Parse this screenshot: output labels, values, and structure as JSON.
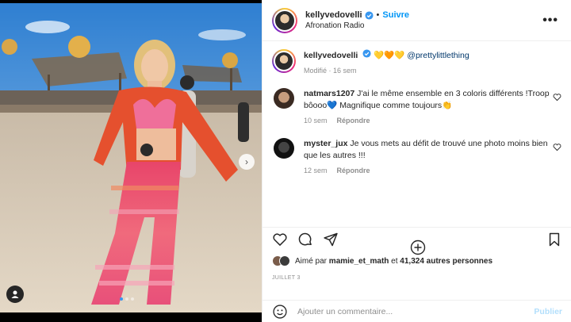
{
  "header": {
    "username": "kellyvedovelli",
    "separator": "•",
    "follow_label": "Suivre",
    "subtitle": "Afronation Radio",
    "more_label": "•••"
  },
  "caption": {
    "username": "kellyvedovelli",
    "emojis": "💛🧡💛",
    "mention": "@prettylittlething",
    "meta_edited": "Modifié · 16 sem"
  },
  "comments": [
    {
      "username": "natmars1207",
      "text": "J'ai le même ensemble en 3 coloris différents !Troop bôooo💙 Magnifique comme toujours👏",
      "time": "10 sem",
      "reply_label": "Répondre"
    },
    {
      "username": "myster_jux",
      "text": "Je vous mets au défit de trouvé une photo moins bien que les autres !!!",
      "time": "12 sem",
      "reply_label": "Répondre"
    }
  ],
  "likes": {
    "prefix": "Aimé par",
    "user": "mamie_et_math",
    "middle": "et",
    "count": "41,324 autres personnes"
  },
  "date": "JUILLET 3",
  "add_comment": {
    "placeholder": "Ajouter un commentaire...",
    "publish_label": "Publier"
  },
  "icons": {
    "verified": "verified-badge-icon",
    "heart": "heart-icon",
    "comment": "comment-icon",
    "share": "share-icon",
    "save": "bookmark-icon",
    "emoji": "emoji-icon",
    "more_comments": "plus-circle-icon"
  },
  "colors": {
    "accent": "#0095f6",
    "verified": "#3897f0",
    "muted": "#8e8e8e"
  }
}
